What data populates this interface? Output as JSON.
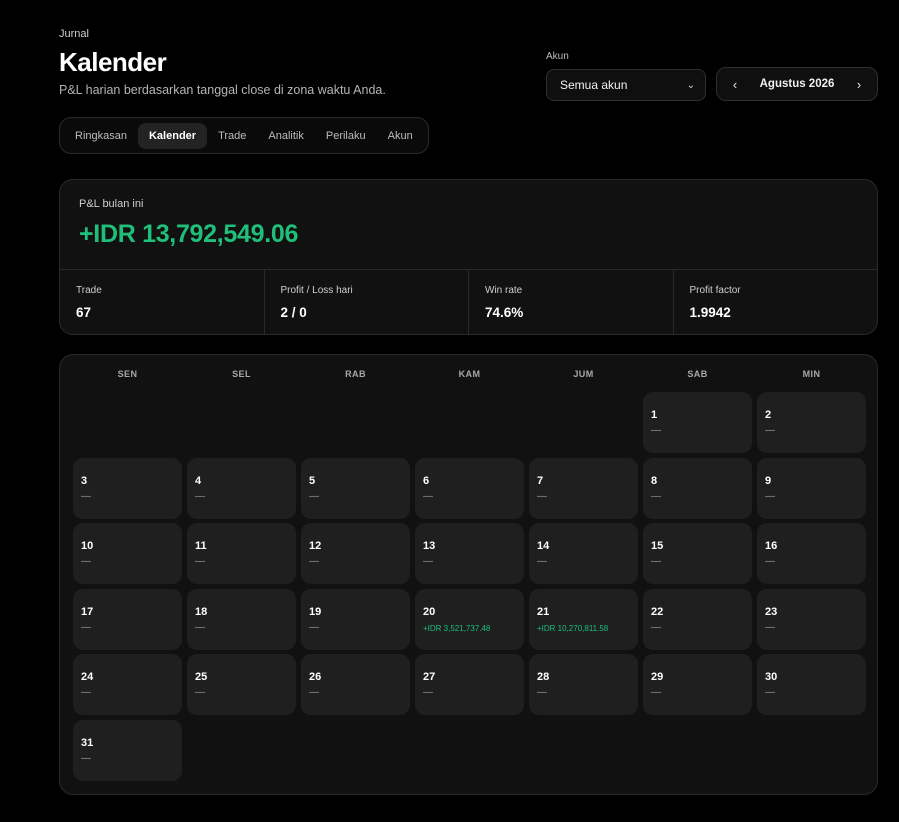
{
  "header": {
    "eyebrow": "Jurnal",
    "title": "Kalender",
    "subtitle": "P&L harian berdasarkan tanggal close di zona waktu Anda."
  },
  "account": {
    "label": "Akun",
    "selected": "Semua akun"
  },
  "month_nav": {
    "prev": "‹",
    "month": "Agustus 2026",
    "next": "›"
  },
  "tabs": [
    {
      "label": "Ringkasan",
      "active": false
    },
    {
      "label": "Kalender",
      "active": true
    },
    {
      "label": "Trade",
      "active": false
    },
    {
      "label": "Analitik",
      "active": false
    },
    {
      "label": "Perilaku",
      "active": false
    },
    {
      "label": "Akun",
      "active": false
    }
  ],
  "summary": {
    "pl_label": "P&L bulan ini",
    "pl_value": "+IDR 13,792,549.06",
    "stats": [
      {
        "label": "Trade",
        "value": "67"
      },
      {
        "label": "Profit / Loss hari",
        "value": "2 / 0"
      },
      {
        "label": "Win rate",
        "value": "74.6%"
      },
      {
        "label": "Profit factor",
        "value": "1.9942"
      }
    ]
  },
  "calendar": {
    "weekdays": [
      "SEN",
      "SEL",
      "RAB",
      "KAM",
      "JUM",
      "SAB",
      "MIN"
    ],
    "leading_blanks": 5,
    "days": [
      {
        "day": "1",
        "pl": "—"
      },
      {
        "day": "2",
        "pl": "—"
      },
      {
        "day": "3",
        "pl": "—"
      },
      {
        "day": "4",
        "pl": "—"
      },
      {
        "day": "5",
        "pl": "—"
      },
      {
        "day": "6",
        "pl": "—"
      },
      {
        "day": "7",
        "pl": "—"
      },
      {
        "day": "8",
        "pl": "—"
      },
      {
        "day": "9",
        "pl": "—"
      },
      {
        "day": "10",
        "pl": "—"
      },
      {
        "day": "11",
        "pl": "—"
      },
      {
        "day": "12",
        "pl": "—"
      },
      {
        "day": "13",
        "pl": "—"
      },
      {
        "day": "14",
        "pl": "—"
      },
      {
        "day": "15",
        "pl": "—"
      },
      {
        "day": "16",
        "pl": "—"
      },
      {
        "day": "17",
        "pl": "—"
      },
      {
        "day": "18",
        "pl": "—"
      },
      {
        "day": "19",
        "pl": "—"
      },
      {
        "day": "20",
        "pl": "+IDR 3,521,737.48",
        "positive": true
      },
      {
        "day": "21",
        "pl": "+IDR 10,270,811.58",
        "positive": true
      },
      {
        "day": "22",
        "pl": "—"
      },
      {
        "day": "23",
        "pl": "—"
      },
      {
        "day": "24",
        "pl": "—"
      },
      {
        "day": "25",
        "pl": "—"
      },
      {
        "day": "26",
        "pl": "—"
      },
      {
        "day": "27",
        "pl": "—"
      },
      {
        "day": "28",
        "pl": "—"
      },
      {
        "day": "29",
        "pl": "—"
      },
      {
        "day": "30",
        "pl": "—"
      },
      {
        "day": "31",
        "pl": "—"
      }
    ]
  },
  "colors": {
    "positive": "#1fbf7a",
    "background": "#000000",
    "card": "#111111",
    "cell": "#1f1f1f"
  }
}
